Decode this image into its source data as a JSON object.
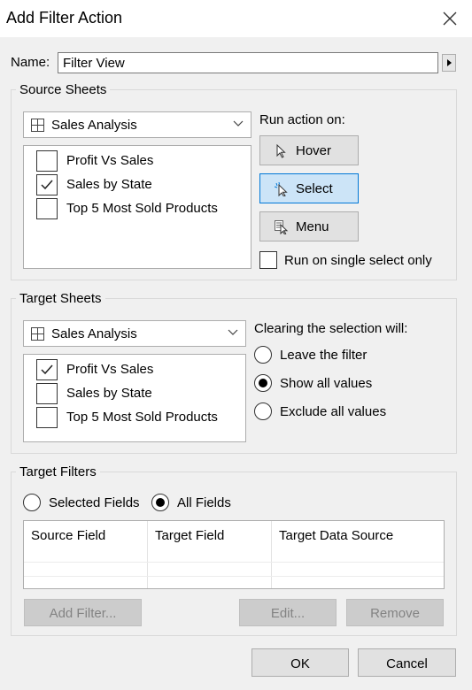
{
  "dialog": {
    "title": "Add Filter Action"
  },
  "name_field": {
    "label": "Name:",
    "value": "Filter View"
  },
  "source_sheets": {
    "group_title": "Source Sheets",
    "dashboard": "Sales Analysis",
    "sheets": [
      {
        "label": "Profit Vs Sales",
        "checked": false
      },
      {
        "label": "Sales by State",
        "checked": true
      },
      {
        "label": "Top 5 Most Sold Products",
        "checked": false
      }
    ],
    "run_action_label": "Run action on:",
    "run_buttons": [
      {
        "label": "Hover",
        "icon": "cursor-icon",
        "selected": false
      },
      {
        "label": "Select",
        "icon": "select-cursor-icon",
        "selected": true
      },
      {
        "label": "Menu",
        "icon": "menu-cursor-icon",
        "selected": false
      }
    ],
    "single_select": {
      "label": "Run on single select only",
      "checked": false
    }
  },
  "target_sheets": {
    "group_title": "Target Sheets",
    "dashboard": "Sales Analysis",
    "sheets": [
      {
        "label": "Profit Vs Sales",
        "checked": true
      },
      {
        "label": "Sales by State",
        "checked": false
      },
      {
        "label": "Top 5 Most Sold Products",
        "checked": false
      }
    ],
    "clearing_label": "Clearing the selection will:",
    "options": [
      {
        "label": "Leave the filter",
        "selected": false
      },
      {
        "label": "Show all values",
        "selected": true
      },
      {
        "label": "Exclude all values",
        "selected": false
      }
    ]
  },
  "target_filters": {
    "group_title": "Target Filters",
    "options": [
      {
        "label": "Selected Fields",
        "selected": false
      },
      {
        "label": "All Fields",
        "selected": true
      }
    ],
    "columns": [
      "Source Field",
      "Target Field",
      "Target Data Source"
    ],
    "buttons": {
      "add": "Add Filter...",
      "edit": "Edit...",
      "remove": "Remove"
    }
  },
  "footer": {
    "ok": "OK",
    "cancel": "Cancel"
  },
  "colors": {
    "selected_button": "#cce4f7",
    "selected_border": "#0078d7",
    "window_bg": "#f0f0f0"
  }
}
